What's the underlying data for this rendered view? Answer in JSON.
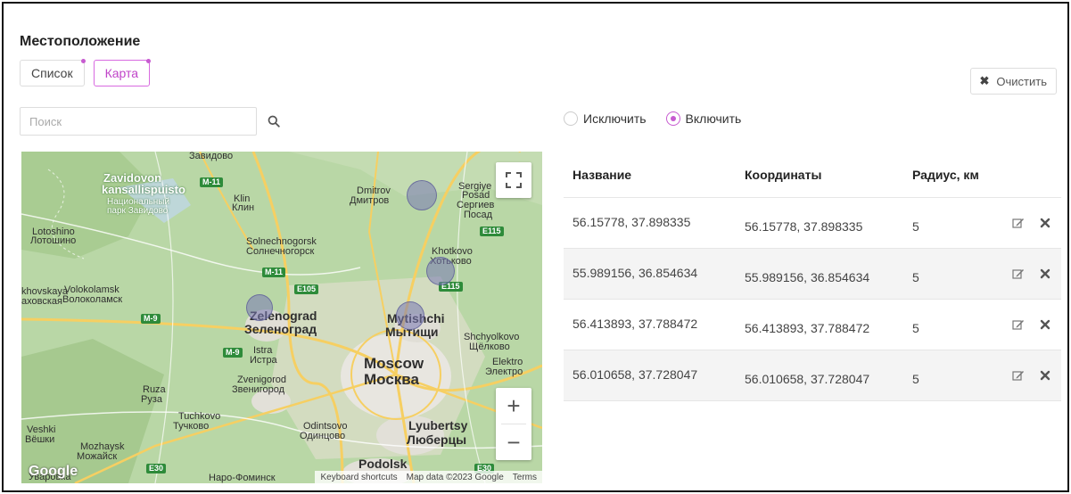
{
  "page": {
    "title": "Местоположение",
    "tabs": [
      {
        "label": "Список",
        "active": false
      },
      {
        "label": "Карта",
        "active": true
      }
    ],
    "clear_button": "Очистить"
  },
  "search": {
    "placeholder": "Поиск",
    "value": ""
  },
  "mode": {
    "options": [
      {
        "label": "Исключить",
        "checked": false
      },
      {
        "label": "Включить",
        "checked": true
      }
    ]
  },
  "map": {
    "labels": {
      "zavidovo_top": "Завидово",
      "zavidovo_park_lat": "Zavidovon",
      "zavidovo_park_lat2": "kansallispuisto",
      "zavidovo_park_ru": "Национальный",
      "zavidovo_park_ru2": "парк Завидово",
      "klin": "Klin",
      "klin_ru": "Клин",
      "dmitrov": "Dmitrov",
      "dmitrov_ru": "Дмитров",
      "sergiev": "Sergiye",
      "sergiev2": "Posad",
      "sergiev_ru": "Сергиев",
      "sergiev_ru2": "Посад",
      "lotoshino": "Lotoshino",
      "lotoshino_ru": "Лотошино",
      "solnechnogorsk": "Solnechnogorsk",
      "solnechnogorsk_ru": "Солнечногорск",
      "khotkovo": "Khotkovo",
      "khotkovo_ru": "Хотьково",
      "volokolamsk": "Volokolamsk",
      "volokolamsk_ru": "Волоколамск",
      "shakhovskaya": "khovskaya",
      "shakhovskaya_ru": "аховская",
      "zelenograd": "Zelenograd",
      "zelenograd_ru": "Зеленоград",
      "mytishchi": "Mytishchi",
      "mytishchi_ru": "Мытищи",
      "shchyolkovo": "Shchyolkovo",
      "shchyolkovo_ru": "Щёлково",
      "istra": "Istra",
      "istra_ru": "Истра",
      "moscow": "Moscow",
      "moscow_ru": "Москва",
      "elektrostal": "Elektro",
      "elektrostal_ru": "Электро",
      "zvenigorod": "Zvenigorod",
      "zvenigorod_ru": "Звенигород",
      "ruza": "Ruza",
      "ruza_ru": "Руза",
      "tuchkovo": "Tuchkovo",
      "tuchkovo_ru": "Тучково",
      "odintsovo": "Odintsovo",
      "odintsovo_ru": "Одинцово",
      "lyubertsy": "Lyubertsy",
      "lyubertsy_ru": "Люберцы",
      "veshki": "Veshki",
      "veshki_ru": "Вёшки",
      "mozhaysk": "Mozhaysk",
      "mozhaysk_ru": "Можайск",
      "podolsk": "Podolsk",
      "naro": "Наро-Фоминск",
      "vereya": "Уваровка"
    },
    "shields": [
      "M-11",
      "M-11",
      "E105",
      "E115",
      "E115",
      "M-9",
      "M-9",
      "E30",
      "E30"
    ],
    "logo": "Google",
    "attribution": {
      "shortcuts": "Keyboard shortcuts",
      "data": "Map data ©2023 Google",
      "terms": "Terms"
    }
  },
  "table": {
    "headers": [
      "Название",
      "Координаты",
      "Радиус, км"
    ],
    "rows": [
      {
        "name": "56.15778, 37.898335",
        "coords": "56.15778, 37.898335",
        "radius": "5"
      },
      {
        "name": "55.989156, 36.854634",
        "coords": "55.989156, 36.854634",
        "radius": "5"
      },
      {
        "name": "56.413893, 37.788472",
        "coords": "56.413893, 37.788472",
        "radius": "5"
      },
      {
        "name": "56.010658, 37.728047",
        "coords": "56.010658, 37.728047",
        "radius": "5"
      }
    ]
  },
  "colors": {
    "accent": "#c75bd0",
    "map_green": "#b9d7a6",
    "road_yellow": "#f6cf62",
    "city": "#e8e6e0"
  }
}
